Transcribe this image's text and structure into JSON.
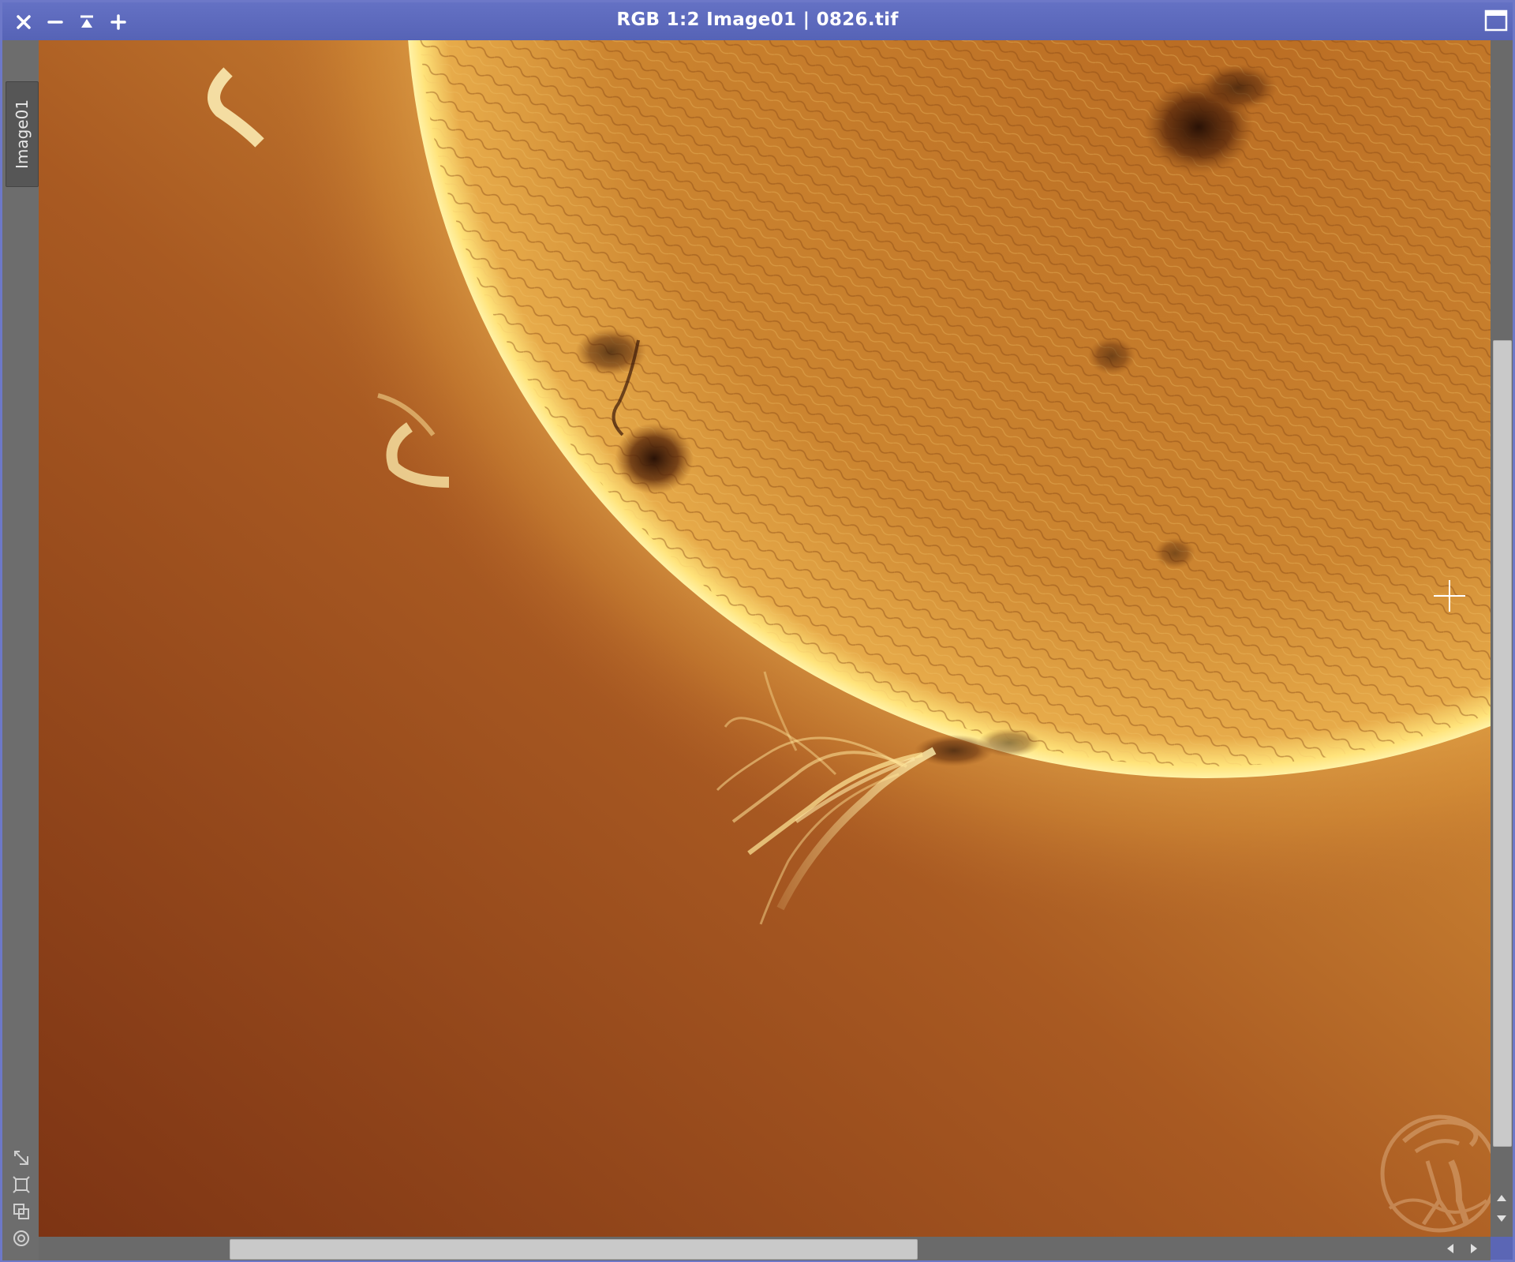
{
  "window": {
    "title": "RGB 1:2 Image01 | 0826.tif",
    "tab_label": "Image01"
  },
  "titlebar": {
    "close_icon": "close-icon",
    "minimize_icon": "minimize-icon",
    "shade_icon": "shade-icon",
    "maximize_icon": "plus-icon",
    "fullscreen_icon": "maximize-window-icon"
  },
  "tools": [
    "resize-icon",
    "fit-view-icon",
    "clone-view-icon",
    "target-icon"
  ],
  "colors": {
    "titlebar": "#5b66b5",
    "solar_disk": "#d08a2a",
    "limb": "#ffe070",
    "background_sky": "#a85a20"
  }
}
